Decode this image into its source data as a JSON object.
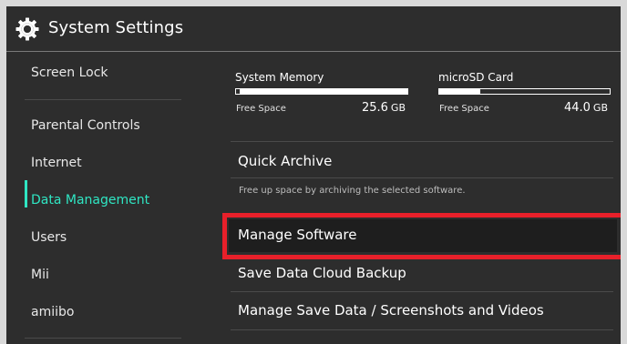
{
  "window": {
    "title": "System Settings",
    "icon": "gear-icon"
  },
  "sidebar": {
    "items": [
      {
        "label": "Screen Lock",
        "active": false
      },
      {
        "label": "Parental Controls",
        "active": false
      },
      {
        "label": "Internet",
        "active": false
      },
      {
        "label": "Data Management",
        "active": true
      },
      {
        "label": "Users",
        "active": false
      },
      {
        "label": "Mii",
        "active": false
      },
      {
        "label": "amiibo",
        "active": false
      }
    ]
  },
  "storage": {
    "system_memory": {
      "label": "System Memory",
      "free_label": "Free Space",
      "free_value": "25.6",
      "free_unit": "GB",
      "used_fraction": 0.01
    },
    "microsd": {
      "label": "microSD Card",
      "free_label": "Free Space",
      "free_value": "44.0",
      "free_unit": "GB",
      "used_fraction": 0.24
    }
  },
  "main": {
    "quick_archive": {
      "label": "Quick Archive",
      "hint": "Free up space by archiving the selected software."
    },
    "manage_software": {
      "label": "Manage Software",
      "selected": true
    },
    "save_data_cloud": {
      "label": "Save Data Cloud Backup"
    },
    "manage_save_data": {
      "label": "Manage Save Data / Screenshots and Videos"
    }
  },
  "colors": {
    "accent": "#2fe6c3",
    "background": "#2d2d2d",
    "highlight": "#e8202a"
  }
}
